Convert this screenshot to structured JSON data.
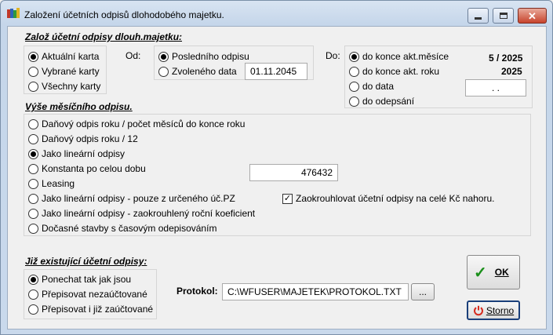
{
  "window": {
    "title": "Založení účetních odpisů dlohodobého majetku."
  },
  "section_main": {
    "title": "Založ účetní odpisy dlouh.majetku:"
  },
  "cards": {
    "options": [
      "Aktuální karta",
      "Vybrané karty",
      "Všechny karty"
    ],
    "selected": 0
  },
  "from": {
    "label": "Od:",
    "options": [
      "Posledního odpisu",
      "Zvoleného data"
    ],
    "selected": 0,
    "date_value": "01.11.2045"
  },
  "to": {
    "label": "Do:",
    "options": [
      "do konce akt.měsíce",
      "do konce akt. roku",
      "do data",
      "do odepsání"
    ],
    "selected": 0,
    "month_value": "5 / 2025",
    "year_value": "2025",
    "date_value": " .  ."
  },
  "monthly": {
    "title": "Výše měsíčního odpisu.",
    "options": [
      "Daňový odpis roku / počet měsíců do konce roku",
      "Daňový odpis roku / 12",
      "Jako lineární odpisy",
      "Konstanta po celou dobu",
      "Leasing",
      "Jako lineární odpisy - pouze z určeného úč.PZ",
      "Jako lineární odpisy - zaokrouhlený roční koeficient",
      "Dočasné stavby s časovým odepisováním"
    ],
    "selected": 2,
    "constant_value": "476432",
    "round_label": "Zaokrouhlovat účetní odpisy na celé Kč nahoru.",
    "round_checked": true
  },
  "existing": {
    "title": "Již existující účetní odpisy:",
    "options": [
      "Ponechat tak jak jsou",
      "Přepisovat nezaúčtované",
      "Přepisovat i již zaúčtované"
    ],
    "selected": 0
  },
  "protocol": {
    "label": "Protokol:",
    "path": "C:\\WFUSER\\MAJETEK\\PROTOKOL.TXT",
    "browse_label": "..."
  },
  "buttons": {
    "ok_label": "OK",
    "cancel_label": "Storno"
  },
  "colors": {
    "ok_check": "#1a8f1a",
    "cancel_icon": "#d62b1f",
    "title_gradient_top": "#d8e4f2"
  }
}
